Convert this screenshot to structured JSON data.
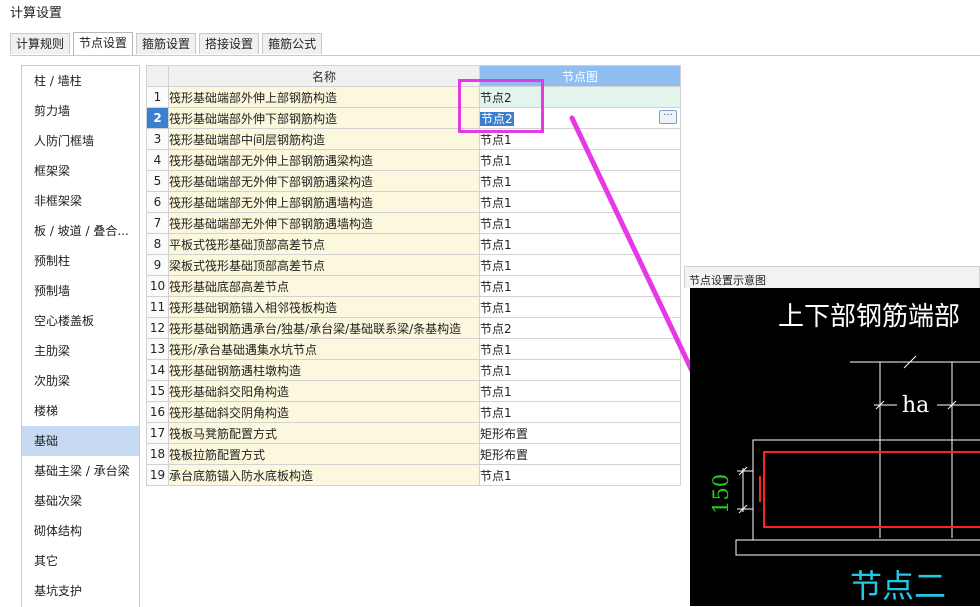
{
  "window": {
    "title": "计算设置"
  },
  "tabs": [
    {
      "label": "计算规则",
      "active": false
    },
    {
      "label": "节点设置",
      "active": true
    },
    {
      "label": "箍筋设置",
      "active": false
    },
    {
      "label": "搭接设置",
      "active": false
    },
    {
      "label": "箍筋公式",
      "active": false
    }
  ],
  "sidebar": {
    "selected": "基础",
    "items": [
      "柱 / 墙柱",
      "剪力墙",
      "人防门框墙",
      "框架梁",
      "非框架梁",
      "板 / 坡道 / 叠合...",
      "预制柱",
      "预制墙",
      "空心楼盖板",
      "主肋梁",
      "次肋梁",
      "楼梯",
      "基础",
      "基础主梁 / 承台梁",
      "基础次梁",
      "砌体结构",
      "其它",
      "基坑支护"
    ]
  },
  "grid": {
    "columns": {
      "index": "",
      "name": "名称",
      "node": "节点图"
    },
    "current_row": 2,
    "rows": [
      {
        "index": "1",
        "name": "筏形基础端部外伸上部钢筋构造",
        "node": "节点2"
      },
      {
        "index": "2",
        "name": "筏形基础端部外伸下部钢筋构造",
        "node": "节点2"
      },
      {
        "index": "3",
        "name": "筏形基础端部中间层钢筋构造",
        "node": "节点1"
      },
      {
        "index": "4",
        "name": "筏形基础端部无外伸上部钢筋遇梁构造",
        "node": "节点1"
      },
      {
        "index": "5",
        "name": "筏形基础端部无外伸下部钢筋遇梁构造",
        "node": "节点1"
      },
      {
        "index": "6",
        "name": "筏形基础端部无外伸上部钢筋遇墙构造",
        "node": "节点1"
      },
      {
        "index": "7",
        "name": "筏形基础端部无外伸下部钢筋遇墙构造",
        "node": "节点1"
      },
      {
        "index": "8",
        "name": "平板式筏形基础顶部高差节点",
        "node": "节点1"
      },
      {
        "index": "9",
        "name": "梁板式筏形基础顶部高差节点",
        "node": "节点1"
      },
      {
        "index": "10",
        "name": "筏形基础底部高差节点",
        "node": "节点1"
      },
      {
        "index": "11",
        "name": "筏形基础钢筋锚入相邻筏板构造",
        "node": "节点1"
      },
      {
        "index": "12",
        "name": "筏形基础钢筋遇承台/独基/承台梁/基础联系梁/条基构造",
        "node": "节点2"
      },
      {
        "index": "13",
        "name": "筏形/承台基础遇集水坑节点",
        "node": "节点1"
      },
      {
        "index": "14",
        "name": "筏形基础钢筋遇柱墩构造",
        "node": "节点1"
      },
      {
        "index": "15",
        "name": "筏形基础斜交阳角构造",
        "node": "节点1"
      },
      {
        "index": "16",
        "name": "筏形基础斜交阴角构造",
        "node": "节点1"
      },
      {
        "index": "17",
        "name": "筏板马凳筋配置方式",
        "node": "矩形布置"
      },
      {
        "index": "18",
        "name": "筏板拉筋配置方式",
        "node": "矩形布置"
      },
      {
        "index": "19",
        "name": "承台底筋锚入防水底板构造",
        "node": "节点1"
      }
    ],
    "edit_button": "···"
  },
  "preview": {
    "title": "节点设置示意图",
    "heading": "上下部钢筋端部",
    "dim_ha": "ha",
    "dim_150": "150",
    "caption": "节点二"
  },
  "colors": {
    "highlight": "#e639e6",
    "selected_nav": "#c6daf1",
    "node_header": "#8fbff2",
    "rebar_red": "#ff2020",
    "dim_green": "#22cc22",
    "caption_cyan": "#22c8e8"
  }
}
